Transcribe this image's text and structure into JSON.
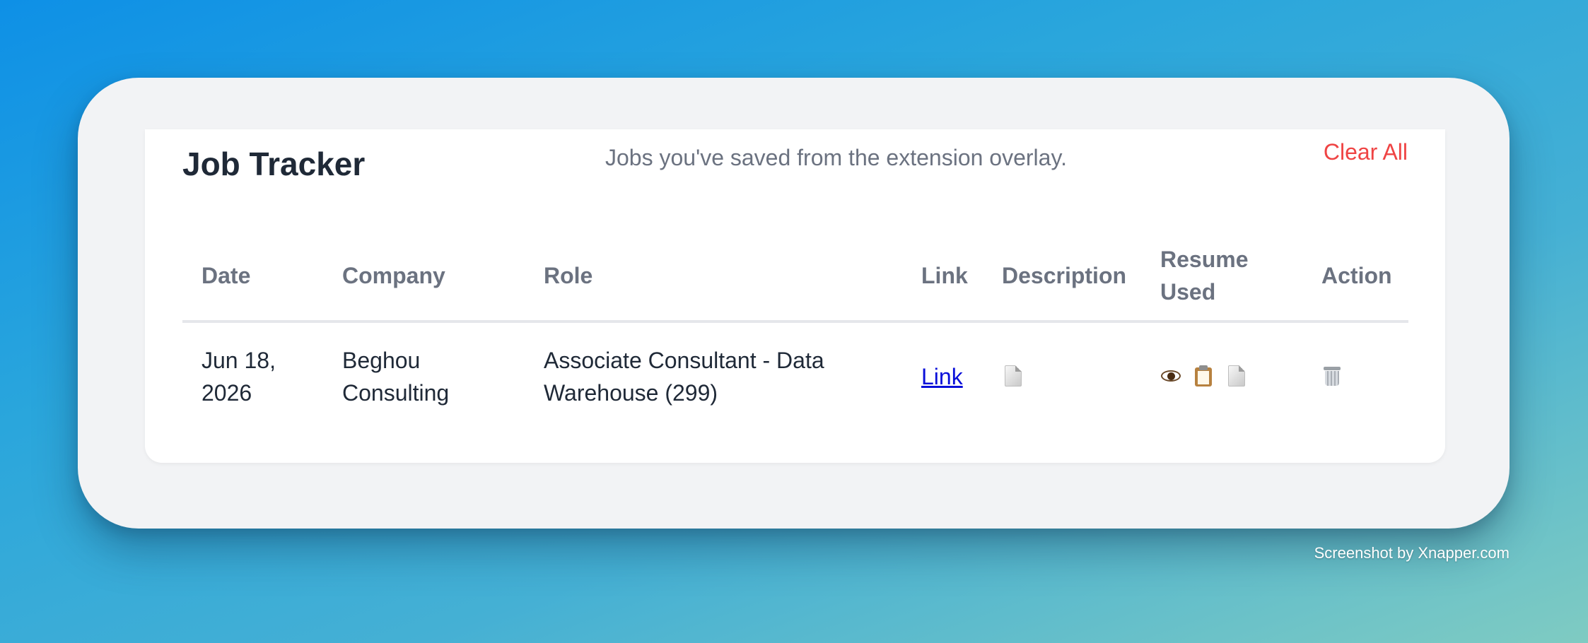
{
  "header": {
    "title": "Job Tracker",
    "subtitle": "Jobs you've saved from the extension overlay.",
    "clear_all_label": "Clear All"
  },
  "table": {
    "columns": {
      "date": "Date",
      "company": "Company",
      "role": "Role",
      "link": "Link",
      "description": "Description",
      "resume_used_line1": "Resume",
      "resume_used_line2": "Used",
      "action": "Action"
    },
    "rows": [
      {
        "date_line1": "Jun 18,",
        "date_line2": "2026",
        "company_line1": "Beghou",
        "company_line2": "Consulting",
        "role_line1": "Associate Consultant - Data",
        "role_line2": "Warehouse (299)",
        "link_label": "Link",
        "description_icon": "document-icon",
        "resume_icons": [
          "eye-icon",
          "clipboard-icon",
          "document-icon"
        ],
        "action_icon": "trash-icon"
      }
    ]
  },
  "footer": {
    "credit": "Screenshot by Xnapper.com"
  }
}
